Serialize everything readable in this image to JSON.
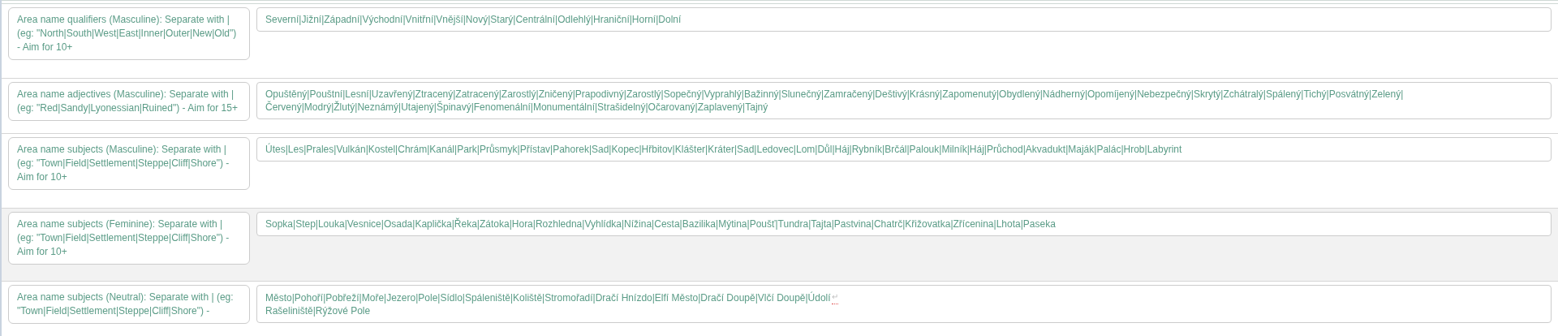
{
  "rows": [
    {
      "label": "Area name qualifiers (Masculine): Separate with | (eg: \"North|South|West|East|Inner|Outer|New|Old\") - Aim for 10+",
      "shaded": false,
      "lines": [
        "Severní|Jižní|Západní|Východní|Vnitřní|Vnější|Nový|Starý|Centrální|Odlehlý|Hraniční|Horní|Dolní"
      ]
    },
    {
      "label": "Area name adjectives (Masculine): Separate with | (eg: \"Red|Sandy|Lyonessian|Ruined\") - Aim for 15+",
      "shaded": false,
      "lines": [
        "Opuštěný|Pouštní|Lesní|Uzavřený|Ztracený|Zatracený|Zarostlý|Zničený|Prapodivný|Zarostlý|Sopečný|Vyprahlý|Bažinný|Slunečný|Zamračený|Deštivý|Krásný|Zapomenutý|Obydlený|Nádherný|Opomíjený|Nebezpečný|Skrytý|Zchátralý|Spálený|Tichý|Posvátný|Zelený|",
        "Červený|Modrý|Žlutý|Neznámý|Utajený|Špinavý|Fenomenální|Monumentální|Strašidelný|Očarovaný|Zaplavený|Tajný"
      ]
    },
    {
      "label": "Area name subjects (Masculine): Separate with | (eg: \"Town|Field|Settlement|Steppe|Cliff|Shore\") - Aim for 10+",
      "shaded": false,
      "lines": [
        "Útes|Les|Prales|Vulkán|Kostel|Chrám|Kanál|Park|Průsmyk|Přístav|Pahorek|Sad|Kopec|Hřbitov|Klášter|Kráter|Sad|Ledovec|Lom|Důl|Háj|Rybník|Brčál|Palouk|Milník|Háj|Průchod|Akvadukt|Maják|Palác|Hrob|Labyrint"
      ]
    },
    {
      "label": "Area name subjects (Feminine): Separate with | (eg: \"Town|Field|Settlement|Steppe|Cliff|Shore\") - Aim for 10+",
      "shaded": true,
      "lines": [
        "Sopka|Step|Louka|Vesnice|Osada|Kaplička|Řeka|Zátoka|Hora|Rozhledna|Vyhlídka|Nížina|Cesta|Bazilika|Mýtina|Poušť|Tundra|Tajta|Pastvina|Chatrč|Křižovatka|Zřícenina|Lhota|Paseka"
      ]
    },
    {
      "label": "Area name subjects (Neutral): Separate with | (eg: \"Town|Field|Settlement|Steppe|Cliff|Shore\") -",
      "shaded": false,
      "lines": [
        "Město|Pohoří|Pobřeží|Moře|Jezero|Pole|Sídlo|Spáleniště|Koliště|Stromořadí|Dračí Hnízdo|Elfí Město|Dračí Doupě|Vlčí Doupě|Údolí",
        "Rašeliniště|Rýžové Pole"
      ],
      "break_mark": "↵"
    }
  ]
}
